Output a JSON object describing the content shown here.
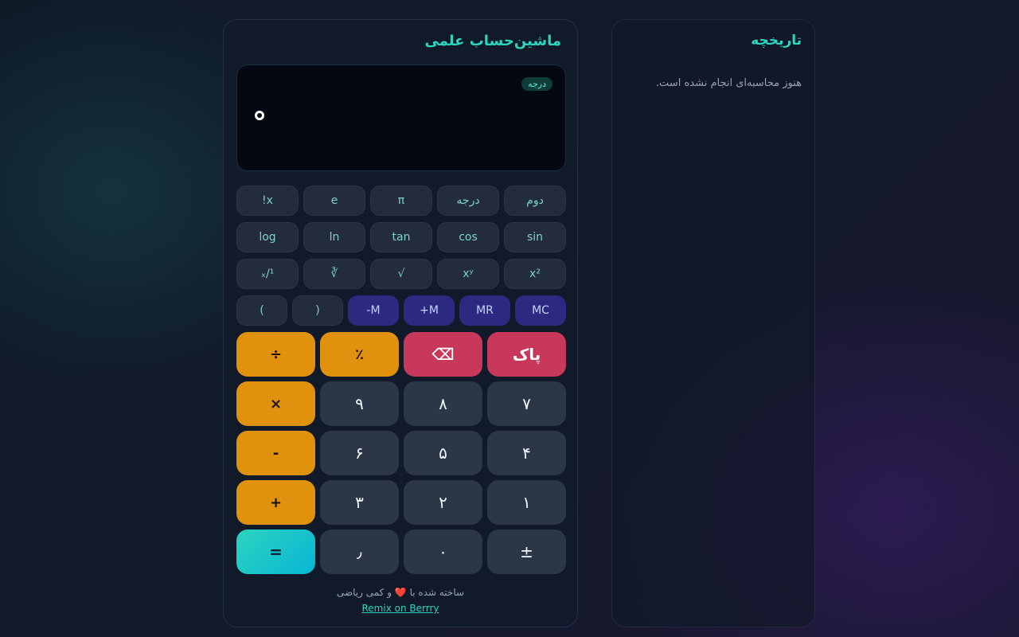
{
  "calculator": {
    "title": "ماشین‌حساب علمی",
    "mode_badge": "درجه",
    "display_value": "۰",
    "sci_rows": [
      [
        "دوم",
        "درجه",
        "π",
        "e",
        "x!"
      ],
      [
        "sin",
        "cos",
        "tan",
        "ln",
        "log"
      ],
      [
        "x²",
        "xʸ",
        "√",
        "∛",
        "¹/ₓ"
      ]
    ],
    "memory_row": [
      "MC",
      "MR",
      "M+",
      "M-",
      "(",
      ")"
    ],
    "keypad_rows": [
      [
        "پاک",
        "⌫",
        "٪",
        "÷"
      ],
      [
        "۷",
        "۸",
        "۹",
        "×"
      ],
      [
        "۴",
        "۵",
        "۶",
        "-"
      ],
      [
        "۱",
        "۲",
        "۳",
        "+"
      ],
      [
        "±",
        "۰",
        "٫",
        "="
      ]
    ],
    "footer_text": "ساخته شده با",
    "footer_heart": "❤️",
    "footer_suffix": "و کمی ریاضی",
    "remix_link": "Remix on Berrry"
  },
  "history": {
    "title": "تاریخچه",
    "empty_message": "هنوز محاسبه‌ای انجام نشده است."
  },
  "colors": {
    "accent": "#2dd4bf",
    "operator": "#e0920f",
    "danger": "#c8385a",
    "memory": "#2b2a80"
  }
}
